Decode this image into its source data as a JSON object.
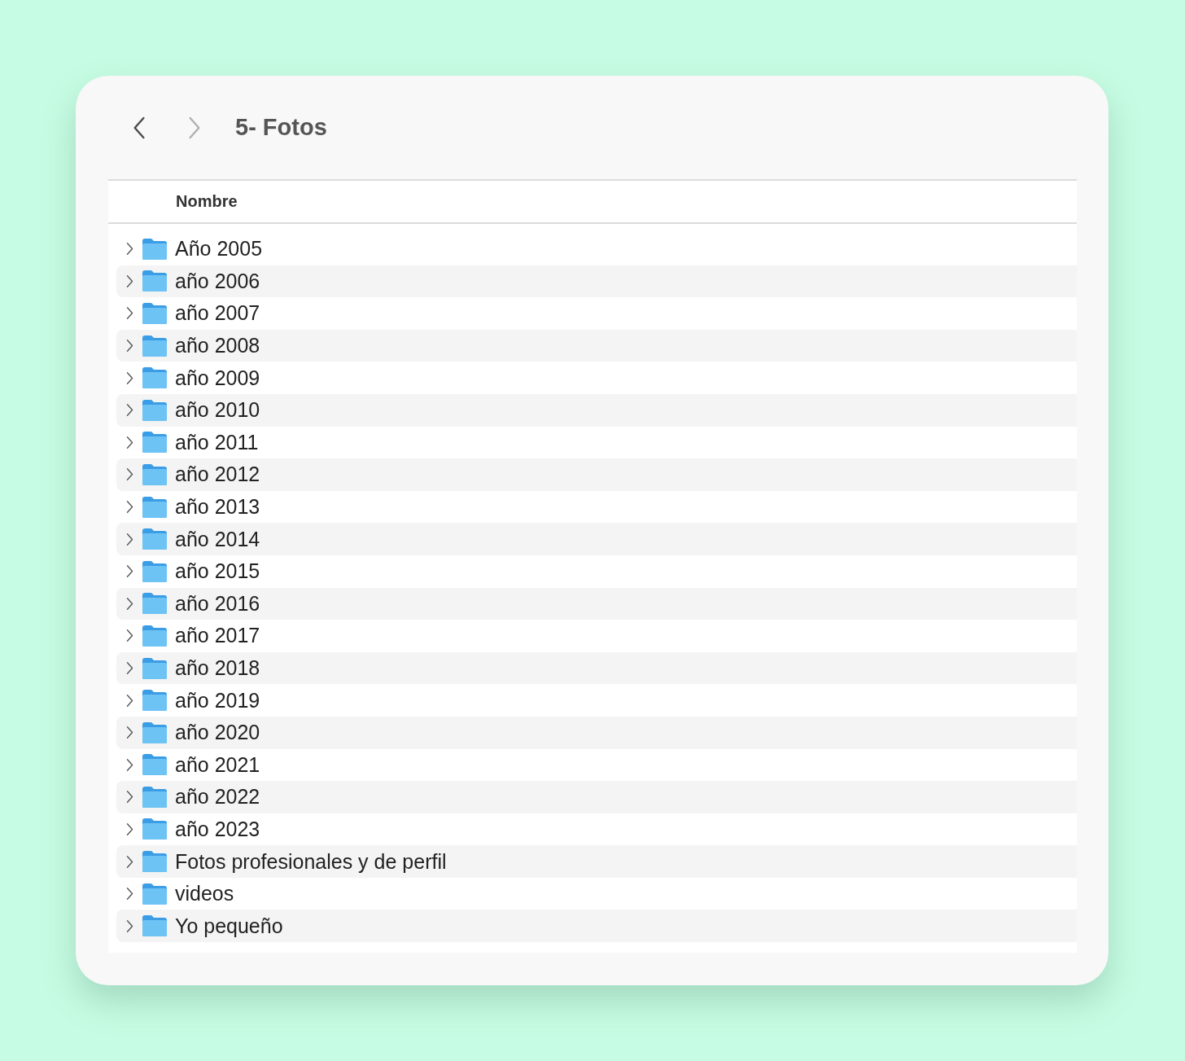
{
  "toolbar": {
    "back": {
      "disabled": false
    },
    "forward": {
      "disabled": true
    },
    "title": "5- Fotos"
  },
  "table": {
    "columns": [
      "Nombre"
    ],
    "rows": [
      {
        "name": "Año 2005",
        "expanded": false
      },
      {
        "name": "año 2006",
        "expanded": false
      },
      {
        "name": "año 2007",
        "expanded": false
      },
      {
        "name": "año 2008",
        "expanded": false
      },
      {
        "name": "año 2009",
        "expanded": false
      },
      {
        "name": "año 2010",
        "expanded": false
      },
      {
        "name": "año 2011",
        "expanded": false
      },
      {
        "name": "año 2012",
        "expanded": false
      },
      {
        "name": "año 2013",
        "expanded": false
      },
      {
        "name": "año 2014",
        "expanded": false
      },
      {
        "name": "año 2015",
        "expanded": false
      },
      {
        "name": "año 2016",
        "expanded": false
      },
      {
        "name": "año 2017",
        "expanded": false
      },
      {
        "name": "año 2018",
        "expanded": false
      },
      {
        "name": "año 2019",
        "expanded": false
      },
      {
        "name": "año 2020",
        "expanded": false
      },
      {
        "name": "año 2021",
        "expanded": false
      },
      {
        "name": "año 2022",
        "expanded": false
      },
      {
        "name": "año 2023",
        "expanded": false
      },
      {
        "name": "Fotos profesionales y de perfil",
        "expanded": false
      },
      {
        "name": "videos",
        "expanded": false
      },
      {
        "name": "Yo pequeño",
        "expanded": false
      }
    ]
  }
}
